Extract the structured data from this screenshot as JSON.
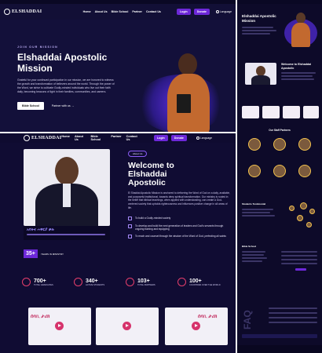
{
  "hero": {
    "logo_text": "ELSHADDAI",
    "menu": [
      "Home",
      "About Us",
      "Bible School",
      "Partner",
      "Contact Us"
    ],
    "login_label": "Login",
    "donate_label": "Donate",
    "language_label": "Language",
    "kicker": "JOIN OUR MISSION",
    "title": "Elshaddai Apostolic Mission",
    "paragraph": "Grateful for your continued participation in our mission, we are honored to witness the growth and transformation of believers around the world. Through the power of the Word, we strive to cultivate Godly-minded individuals who live out their faith daily, becoming beacons of light in their families, communities, and careers.",
    "cta_primary": "Bible School",
    "cta_secondary": "Partner with us →"
  },
  "main": {
    "logo_text": "ELSHADDAI",
    "menu": [
      "Home",
      "About Us",
      "Bible School",
      "Partner",
      "Contact Us"
    ],
    "login_label": "Login",
    "donate_label": "Donate",
    "language_label": "Language",
    "badge": "About Us",
    "title": "Welcome to Elshaddai Apostolic",
    "paragraph": "El Shaddai Apostolic Mission is anchored to delivering the Word of God on a daily, available, and purposeful institutional, towards deep spiritual transformation. Our ministry is rooted in the belief that biblical teachings, when applied with understanding, can create a God-centered society that upholds righteousness and influences positive change in all areas of life.",
    "bullets": [
      "To build a Godly-minded society",
      "To develop and build the next generation of leaders and God's servants through ongoing training and equipping",
      "To reach and counsel through the wisdom of the Word of God, perfecting all saints"
    ],
    "years_num": "35+",
    "years_label": "YEARS IN MINISTRY",
    "stats": [
      {
        "num": "700+",
        "label": "TOTAL GRADUATES"
      },
      {
        "num": "340+",
        "label": "ACTIVE STUDENTS"
      },
      {
        "num": "103+",
        "label": "TOTAL PARTNERS"
      },
      {
        "num": "100+",
        "label": "COUNTRIES OVER THE WORLD"
      }
    ],
    "video_caption": "ሰባኪ ታሪክ"
  },
  "side": {
    "title": "Elshaddai Apostolic Mission",
    "welcome": "Welcome to Elshaddai Apostolic",
    "partners_title": "Our Staff Partners",
    "testimonial_title": "Students Testimonial",
    "bible_title": "Bible School",
    "faq_label": "FAQ"
  },
  "colors": {
    "accent": "#6d28d9",
    "pink": "#e53e6b",
    "bg": "#100c33"
  }
}
